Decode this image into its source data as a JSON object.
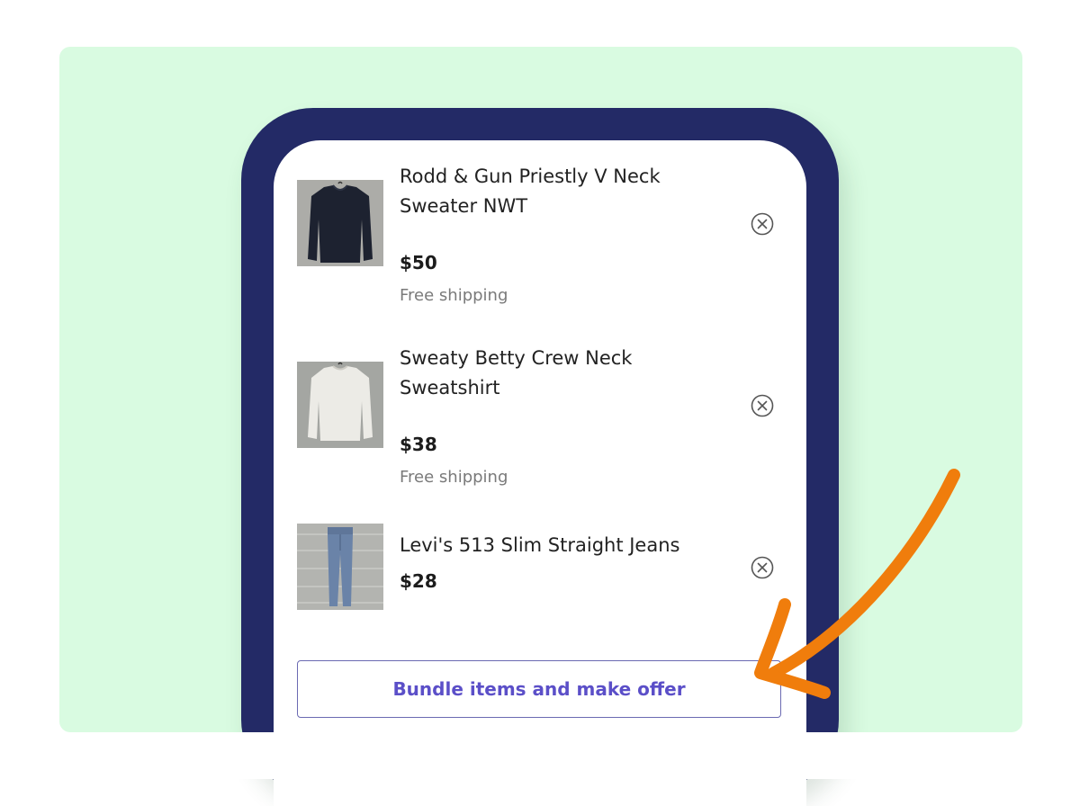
{
  "items": [
    {
      "title": "Rodd & Gun Priestly V Neck Sweater NWT",
      "price": "$50",
      "shipping": "Free shipping",
      "thumbnail": "navy-sweater-photo"
    },
    {
      "title": "Sweaty Betty Crew Neck Sweatshirt",
      "price": "$38",
      "shipping": "Free shipping",
      "thumbnail": "white-sweatshirt-photo"
    },
    {
      "title": "Levi's 513 Slim Straight Jeans",
      "price": "$28",
      "thumbnail": "jeans-photo"
    }
  ],
  "remove_icon": "circle-x-icon",
  "bundle_button_label": "Bundle items and make offer",
  "annotation": {
    "icon": "curved-arrow-icon",
    "color": "#f07d0c"
  },
  "colors": {
    "background_panel": "#d9fbe1",
    "phone_frame": "#232a66",
    "button_text": "#5b4fc8",
    "button_border": "#6b6ab2"
  }
}
